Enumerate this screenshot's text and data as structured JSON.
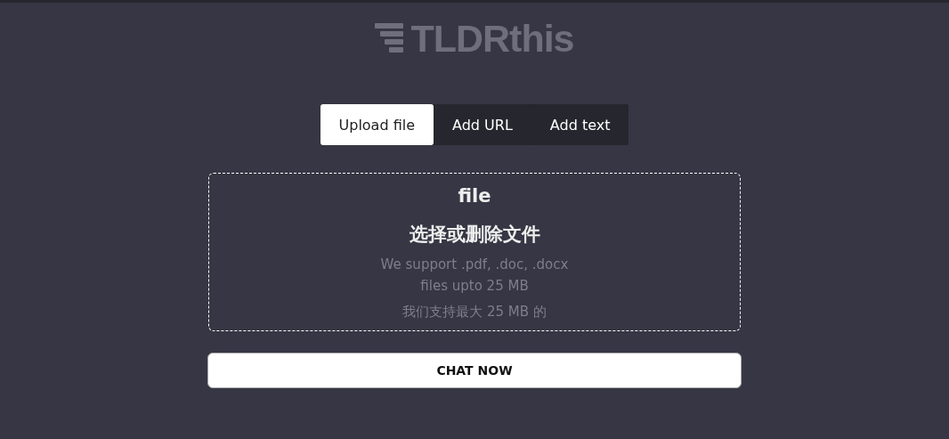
{
  "logo": {
    "text": "TLDRthis"
  },
  "tabs": [
    {
      "label": "Upload file",
      "selected": true
    },
    {
      "label": "Add URL",
      "selected": false
    },
    {
      "label": "Add text",
      "selected": false
    }
  ],
  "dropzone": {
    "title": "file",
    "title_zh": "选择或删除文件",
    "support": "We support .pdf, .doc, .docx",
    "support_2": "files upto 25 MB",
    "support_zh": "我们支持最大 25 MB 的"
  },
  "chat_button": "CHAT NOW"
}
